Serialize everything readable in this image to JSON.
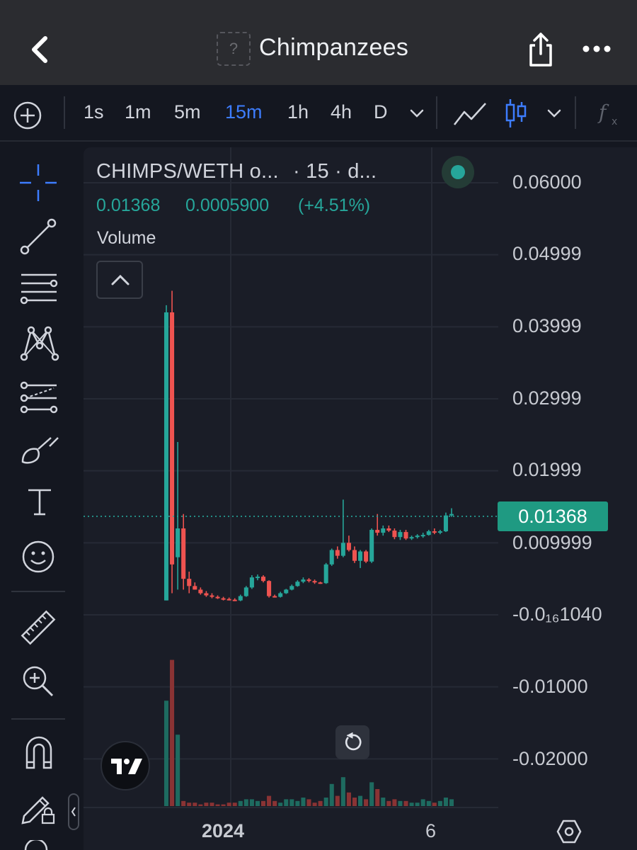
{
  "header": {
    "title": "Chimpanzees",
    "logo_placeholder": "?",
    "icons": [
      "back-chevron-icon",
      "share-icon",
      "more-dots-icon"
    ]
  },
  "toolbar": {
    "timeframes": [
      "1s",
      "1m",
      "5m",
      "15m",
      "1h",
      "4h",
      "D"
    ],
    "active_timeframe": "15m",
    "icons": [
      "add-indicator-icon",
      "timeframe-dropdown-icon",
      "line-chart-icon",
      "candles-icon",
      "chart-type-dropdown-icon",
      "fx-icon"
    ]
  },
  "left_toolbar": {
    "tools": [
      "crosshair-icon",
      "trend-line-icon",
      "fib-retracement-icon",
      "pattern-icon",
      "forecast-icon",
      "brush-icon",
      "text-icon",
      "emoji-icon",
      "ruler-icon",
      "zoom-in-icon",
      "magnet-icon",
      "lock-drawings-icon"
    ]
  },
  "chart": {
    "symbol": "CHIMPS/WETH o...",
    "interval_text": "· 15 · d...",
    "last": "0.01368",
    "change": "0.0005900",
    "change_pct": "(+4.51%)",
    "volume_label": "Volume",
    "price_badge": "0.01368",
    "colors": {
      "up": "#26a69a",
      "down": "#ef5350",
      "badge": "#1f9a82",
      "active": "#3d7dff"
    }
  },
  "chart_data": {
    "type": "candlestick",
    "y_tick_labels": [
      "0.06000",
      "0.04999",
      "0.03999",
      "0.02999",
      "0.01999",
      "0.009999",
      "-0.0₁₆1040",
      "-0.01000",
      "-0.02000"
    ],
    "x_tick_labels": [
      "2024",
      "6"
    ],
    "last_price": 0.01368,
    "ylim": [
      -0.024,
      0.062
    ],
    "candles": [
      {
        "o": 0.002,
        "h": 0.043,
        "l": 0.002,
        "c": 0.042,
        "d": "up"
      },
      {
        "o": 0.042,
        "h": 0.045,
        "l": 0.003,
        "c": 0.007,
        "d": "down"
      },
      {
        "o": 0.008,
        "h": 0.024,
        "l": 0.0035,
        "c": 0.012,
        "d": "up"
      },
      {
        "o": 0.012,
        "h": 0.014,
        "l": 0.0035,
        "c": 0.005,
        "d": "down"
      },
      {
        "o": 0.005,
        "h": 0.006,
        "l": 0.003,
        "c": 0.004,
        "d": "down"
      },
      {
        "o": 0.004,
        "h": 0.0045,
        "l": 0.0035,
        "c": 0.0035,
        "d": "down"
      },
      {
        "o": 0.0035,
        "h": 0.0038,
        "l": 0.0028,
        "c": 0.003,
        "d": "down"
      },
      {
        "o": 0.003,
        "h": 0.0033,
        "l": 0.0025,
        "c": 0.0027,
        "d": "down"
      },
      {
        "o": 0.0027,
        "h": 0.003,
        "l": 0.0023,
        "c": 0.0025,
        "d": "down"
      },
      {
        "o": 0.0025,
        "h": 0.0027,
        "l": 0.0022,
        "c": 0.0023,
        "d": "down"
      },
      {
        "o": 0.0023,
        "h": 0.0025,
        "l": 0.002,
        "c": 0.0022,
        "d": "down"
      },
      {
        "o": 0.0022,
        "h": 0.0024,
        "l": 0.002,
        "c": 0.0021,
        "d": "down"
      },
      {
        "o": 0.0021,
        "h": 0.0023,
        "l": 0.0019,
        "c": 0.002,
        "d": "down"
      },
      {
        "o": 0.002,
        "h": 0.0028,
        "l": 0.0019,
        "c": 0.0026,
        "d": "up"
      },
      {
        "o": 0.0026,
        "h": 0.004,
        "l": 0.0025,
        "c": 0.0038,
        "d": "up"
      },
      {
        "o": 0.0038,
        "h": 0.0055,
        "l": 0.0036,
        "c": 0.0052,
        "d": "up"
      },
      {
        "o": 0.0052,
        "h": 0.0056,
        "l": 0.0048,
        "c": 0.0053,
        "d": "up"
      },
      {
        "o": 0.0053,
        "h": 0.0055,
        "l": 0.0045,
        "c": 0.0047,
        "d": "down"
      },
      {
        "o": 0.0047,
        "h": 0.0048,
        "l": 0.0024,
        "c": 0.0026,
        "d": "down"
      },
      {
        "o": 0.0026,
        "h": 0.0028,
        "l": 0.0024,
        "c": 0.0025,
        "d": "down"
      },
      {
        "o": 0.0025,
        "h": 0.0032,
        "l": 0.0024,
        "c": 0.003,
        "d": "up"
      },
      {
        "o": 0.003,
        "h": 0.0036,
        "l": 0.0029,
        "c": 0.0035,
        "d": "up"
      },
      {
        "o": 0.0035,
        "h": 0.0042,
        "l": 0.0034,
        "c": 0.004,
        "d": "up"
      },
      {
        "o": 0.004,
        "h": 0.0048,
        "l": 0.0039,
        "c": 0.0046,
        "d": "up"
      },
      {
        "o": 0.0046,
        "h": 0.0052,
        "l": 0.0044,
        "c": 0.0049,
        "d": "up"
      },
      {
        "o": 0.0049,
        "h": 0.0051,
        "l": 0.0045,
        "c": 0.0047,
        "d": "down"
      },
      {
        "o": 0.0047,
        "h": 0.0049,
        "l": 0.0043,
        "c": 0.0045,
        "d": "down"
      },
      {
        "o": 0.0045,
        "h": 0.0046,
        "l": 0.0043,
        "c": 0.0044,
        "d": "down"
      },
      {
        "o": 0.0044,
        "h": 0.0072,
        "l": 0.0043,
        "c": 0.007,
        "d": "up"
      },
      {
        "o": 0.007,
        "h": 0.0092,
        "l": 0.0068,
        "c": 0.009,
        "d": "up"
      },
      {
        "o": 0.009,
        "h": 0.0095,
        "l": 0.0078,
        "c": 0.0082,
        "d": "down"
      },
      {
        "o": 0.0082,
        "h": 0.016,
        "l": 0.008,
        "c": 0.01,
        "d": "up"
      },
      {
        "o": 0.01,
        "h": 0.011,
        "l": 0.0088,
        "c": 0.009,
        "d": "down"
      },
      {
        "o": 0.009,
        "h": 0.0095,
        "l": 0.0072,
        "c": 0.0075,
        "d": "down"
      },
      {
        "o": 0.0075,
        "h": 0.009,
        "l": 0.0065,
        "c": 0.0088,
        "d": "up"
      },
      {
        "o": 0.0088,
        "h": 0.009,
        "l": 0.0072,
        "c": 0.0074,
        "d": "down"
      },
      {
        "o": 0.0074,
        "h": 0.012,
        "l": 0.0072,
        "c": 0.0118,
        "d": "up"
      },
      {
        "o": 0.0118,
        "h": 0.014,
        "l": 0.011,
        "c": 0.0114,
        "d": "down"
      },
      {
        "o": 0.0114,
        "h": 0.0124,
        "l": 0.011,
        "c": 0.012,
        "d": "up"
      },
      {
        "o": 0.012,
        "h": 0.0124,
        "l": 0.0115,
        "c": 0.0117,
        "d": "down"
      },
      {
        "o": 0.0117,
        "h": 0.012,
        "l": 0.0105,
        "c": 0.0108,
        "d": "down"
      },
      {
        "o": 0.0108,
        "h": 0.0118,
        "l": 0.0104,
        "c": 0.0115,
        "d": "up"
      },
      {
        "o": 0.0115,
        "h": 0.0118,
        "l": 0.0104,
        "c": 0.0106,
        "d": "down"
      },
      {
        "o": 0.0106,
        "h": 0.011,
        "l": 0.0104,
        "c": 0.0108,
        "d": "up"
      },
      {
        "o": 0.0108,
        "h": 0.0112,
        "l": 0.0106,
        "c": 0.011,
        "d": "up"
      },
      {
        "o": 0.011,
        "h": 0.0114,
        "l": 0.0107,
        "c": 0.0111,
        "d": "up"
      },
      {
        "o": 0.0111,
        "h": 0.0118,
        "l": 0.011,
        "c": 0.0116,
        "d": "up"
      },
      {
        "o": 0.0116,
        "h": 0.012,
        "l": 0.0112,
        "c": 0.0114,
        "d": "down"
      },
      {
        "o": 0.0114,
        "h": 0.0118,
        "l": 0.0112,
        "c": 0.0116,
        "d": "up"
      },
      {
        "o": 0.0116,
        "h": 0.0142,
        "l": 0.0115,
        "c": 0.0138,
        "d": "up"
      },
      {
        "o": 0.0138,
        "h": 0.0148,
        "l": 0.0136,
        "c": 0.014,
        "d": "up"
      }
    ],
    "volume": [
      0.62,
      0.86,
      0.42,
      0.03,
      0.02,
      0.02,
      0.01,
      0.02,
      0.02,
      0.01,
      0.01,
      0.02,
      0.02,
      0.03,
      0.04,
      0.04,
      0.03,
      0.03,
      0.06,
      0.03,
      0.02,
      0.04,
      0.04,
      0.03,
      0.05,
      0.04,
      0.02,
      0.03,
      0.05,
      0.13,
      0.06,
      0.17,
      0.08,
      0.05,
      0.06,
      0.04,
      0.14,
      0.1,
      0.05,
      0.03,
      0.04,
      0.03,
      0.03,
      0.02,
      0.02,
      0.04,
      0.03,
      0.02,
      0.03,
      0.05,
      0.04
    ]
  },
  "bottom": {
    "icons": [
      "tradingview-logo-icon",
      "reset-chart-icon",
      "settings-hex-icon",
      "side-panel-handle-icon"
    ]
  }
}
